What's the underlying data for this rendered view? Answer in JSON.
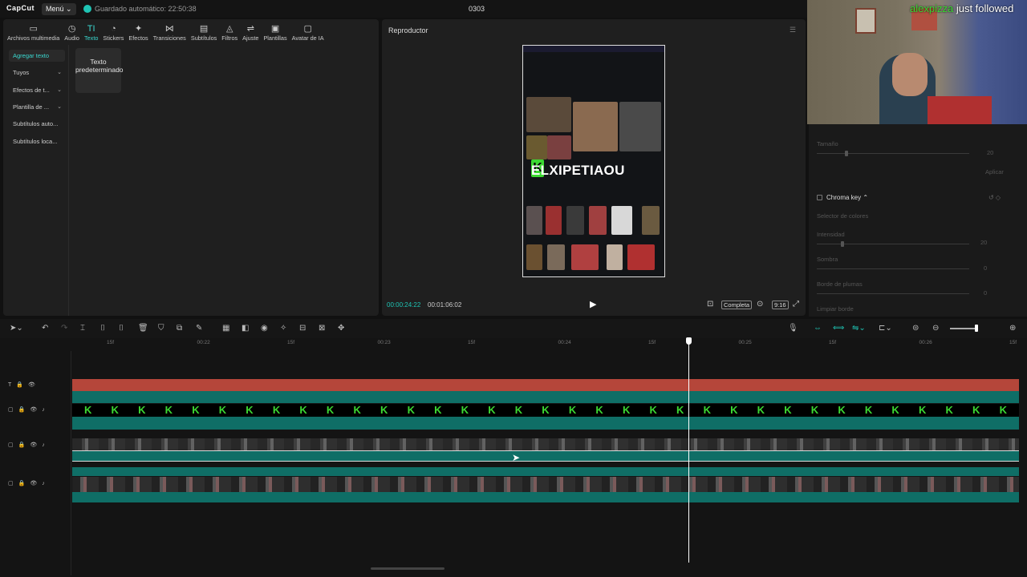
{
  "topbar": {
    "logo": "CapCut",
    "menu": "Menú ⌄",
    "saved": "Guardado automático: 22:50:38",
    "title": "0303"
  },
  "tools": [
    {
      "icon": "▭",
      "label": "Archivos multimedia"
    },
    {
      "icon": "◷",
      "label": "Audio"
    },
    {
      "icon": "TI",
      "label": "Texto"
    },
    {
      "icon": "◔",
      "label": "Stickers"
    },
    {
      "icon": "✦",
      "label": "Efectos"
    },
    {
      "icon": "⋈",
      "label": "Transiciones"
    },
    {
      "icon": "▤",
      "label": "Subtítulos"
    },
    {
      "icon": "◬",
      "label": "Filtros"
    },
    {
      "icon": "⇌",
      "label": "Ajuste"
    },
    {
      "icon": "▣",
      "label": "Plantillas"
    },
    {
      "icon": "▢",
      "label": "Avatar de IA"
    }
  ],
  "leftnav": [
    {
      "label": "Agregar texto",
      "chev": ""
    },
    {
      "label": "Tuyos",
      "chev": "⌄"
    },
    {
      "label": "Efectos de t...",
      "chev": "⌄"
    },
    {
      "label": "Plantilla de ...",
      "chev": "⌄"
    },
    {
      "label": "Subtítulos auto...",
      "chev": ""
    },
    {
      "label": "Subtítulos loca...",
      "chev": ""
    }
  ],
  "default_text": "Texto predeterminado",
  "player": {
    "title": "Reproductor",
    "overlay_text": "ELXIPETIAOU",
    "overlay_k": "K",
    "time_current": "00:00:24:22",
    "time_total": "00:01:06:02",
    "full_label": "Completa",
    "ratio_label": "9:16"
  },
  "props": {
    "size_label": "Tamaño",
    "size_value": "20",
    "apply_label": "Aplicar",
    "chroma_label": "Chroma key ⌃",
    "color_picker_label": "Selector de colores",
    "intensity_label": "Intensidad",
    "intensity_value": "20",
    "shadow_label": "Sombra",
    "shadow_value": "0",
    "feather_label": "Borde de plumas",
    "feather_value": "0",
    "clean_label": "Limpiar borde"
  },
  "webcam": {
    "user": "alexpizza",
    "event": "just followed"
  },
  "ruler": [
    "15f",
    "00:22",
    "15f",
    "00:23",
    "15f",
    "00:24",
    "15f",
    "00:25",
    "15f",
    "00:26",
    "15f"
  ],
  "timeline": {
    "k_count": 35,
    "k_char": "K"
  }
}
